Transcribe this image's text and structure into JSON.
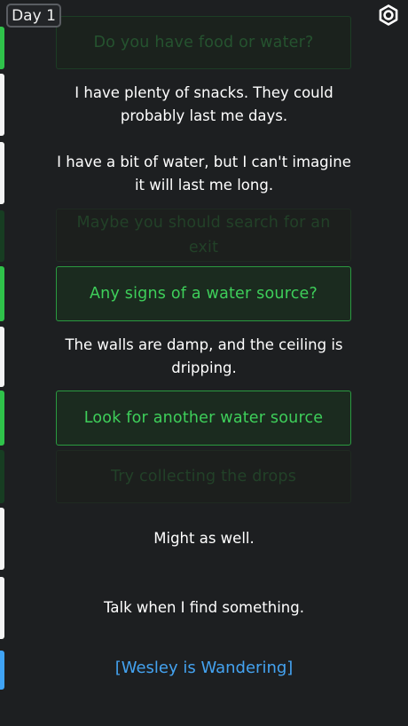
{
  "header": {
    "day_label": "Day 1",
    "settings_icon": "gear-icon"
  },
  "conversation": [
    {
      "kind": "choice",
      "state": "faded",
      "text": "Do you have food or water?"
    },
    {
      "kind": "message",
      "text": "I have plenty of snacks. They could probably last me days."
    },
    {
      "kind": "message",
      "text": "I have a bit of water, but I can't imagine it will last me long."
    },
    {
      "kind": "choice",
      "state": "faded",
      "text": "Maybe you should search for an exit"
    },
    {
      "kind": "choice",
      "state": "selected",
      "text": "Any signs of a water source?"
    },
    {
      "kind": "message",
      "text": "The walls are damp, and the ceiling is dripping."
    },
    {
      "kind": "choice",
      "state": "selected",
      "text": "Look for another water source"
    },
    {
      "kind": "choice",
      "state": "faded",
      "text": "Try collecting the drops"
    },
    {
      "kind": "message",
      "text": "Might as well."
    },
    {
      "kind": "message",
      "text": "Talk when I find something."
    },
    {
      "kind": "status",
      "text": "[Wesley is Wandering]"
    }
  ],
  "colors": {
    "background": "#1d1f21",
    "accent_green": "#3ecf5a",
    "status_blue": "#44a3f1",
    "message_text": "#ffffff"
  }
}
